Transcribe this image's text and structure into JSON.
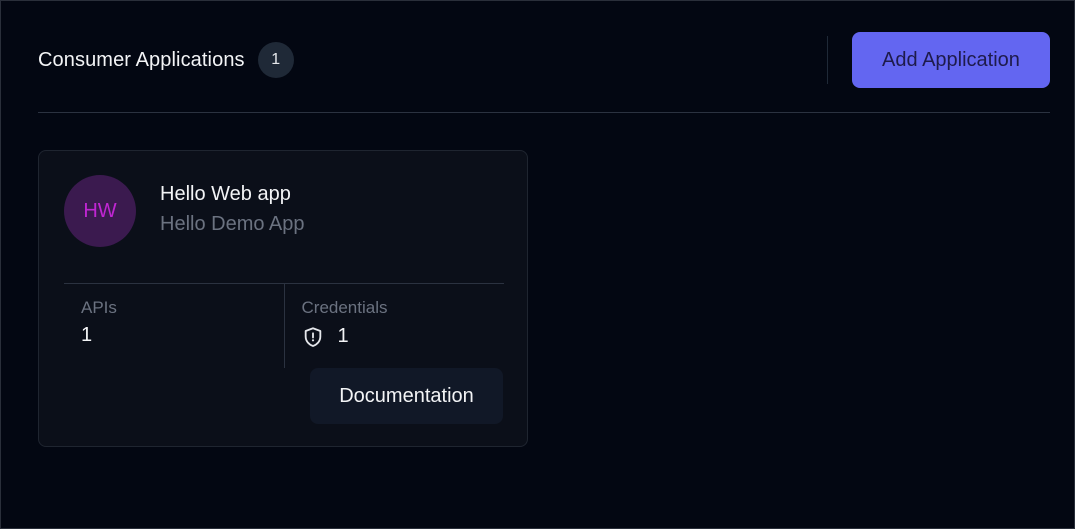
{
  "header": {
    "title": "Consumer Applications",
    "count": "1",
    "add_button_label": "Add Application"
  },
  "colors": {
    "background": "#030712",
    "accent": "#6366f1",
    "avatar_bg": "#3b1a4f",
    "avatar_text": "#c026d3"
  },
  "applications": [
    {
      "initials": "HW",
      "name": "Hello Web app",
      "description": "Hello Demo App",
      "apis_label": "APIs",
      "apis_value": "1",
      "credentials_label": "Credentials",
      "credentials_icon": "shield-icon",
      "credentials_value": "1",
      "documentation_label": "Documentation"
    }
  ]
}
